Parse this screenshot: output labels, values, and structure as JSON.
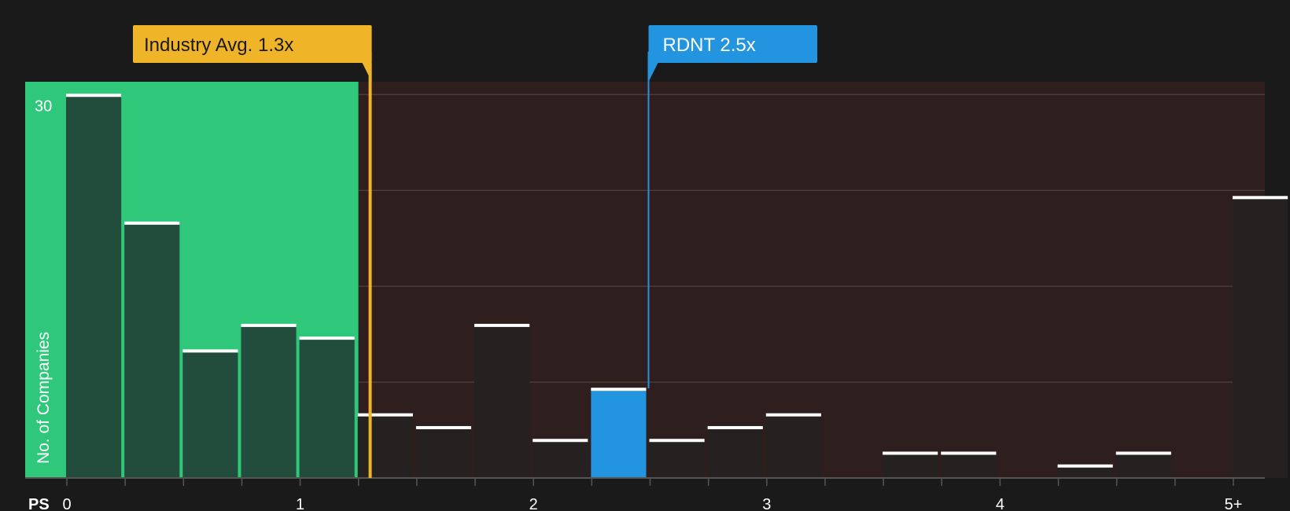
{
  "chart_data": {
    "type": "bar",
    "xlabel": "PS",
    "ylabel": "No. of Companies",
    "x_ticks": [
      "0",
      "1",
      "2",
      "3",
      "4",
      "5+"
    ],
    "y_ticks": [
      "30"
    ],
    "ylim": [
      0,
      31
    ],
    "xlim": [
      0,
      5.13
    ],
    "bin_width": 0.25,
    "bins": [
      {
        "x": 0.0,
        "count": 30
      },
      {
        "x": 0.25,
        "count": 20
      },
      {
        "x": 0.5,
        "count": 10
      },
      {
        "x": 0.75,
        "count": 12
      },
      {
        "x": 1.0,
        "count": 11
      },
      {
        "x": 1.25,
        "count": 5
      },
      {
        "x": 1.5,
        "count": 4
      },
      {
        "x": 1.75,
        "count": 12
      },
      {
        "x": 2.0,
        "count": 3
      },
      {
        "x": 2.25,
        "count": 7
      },
      {
        "x": 2.5,
        "count": 3
      },
      {
        "x": 2.75,
        "count": 4
      },
      {
        "x": 3.0,
        "count": 5
      },
      {
        "x": 3.5,
        "count": 2
      },
      {
        "x": 3.75,
        "count": 2
      },
      {
        "x": 4.25,
        "count": 1
      },
      {
        "x": 4.5,
        "count": 2
      },
      {
        "x": 5.0,
        "count": 22
      }
    ],
    "highlight_bin_x": 2.25,
    "industry_avg": {
      "label": "Industry Avg. 1.3x",
      "value": 1.3
    },
    "company": {
      "label": "RDNT 2.5x",
      "value": 2.5
    },
    "colors": {
      "good_zone": "#2fc87b",
      "bad_zone": "#2f1e1e",
      "bar_good": "#22473a",
      "bar_bad": "#252121",
      "highlight": "#2394e0",
      "industry": "#f0b429",
      "company": "#2394e0",
      "grid": "#4a3c3c",
      "text": "#ffffff"
    }
  }
}
